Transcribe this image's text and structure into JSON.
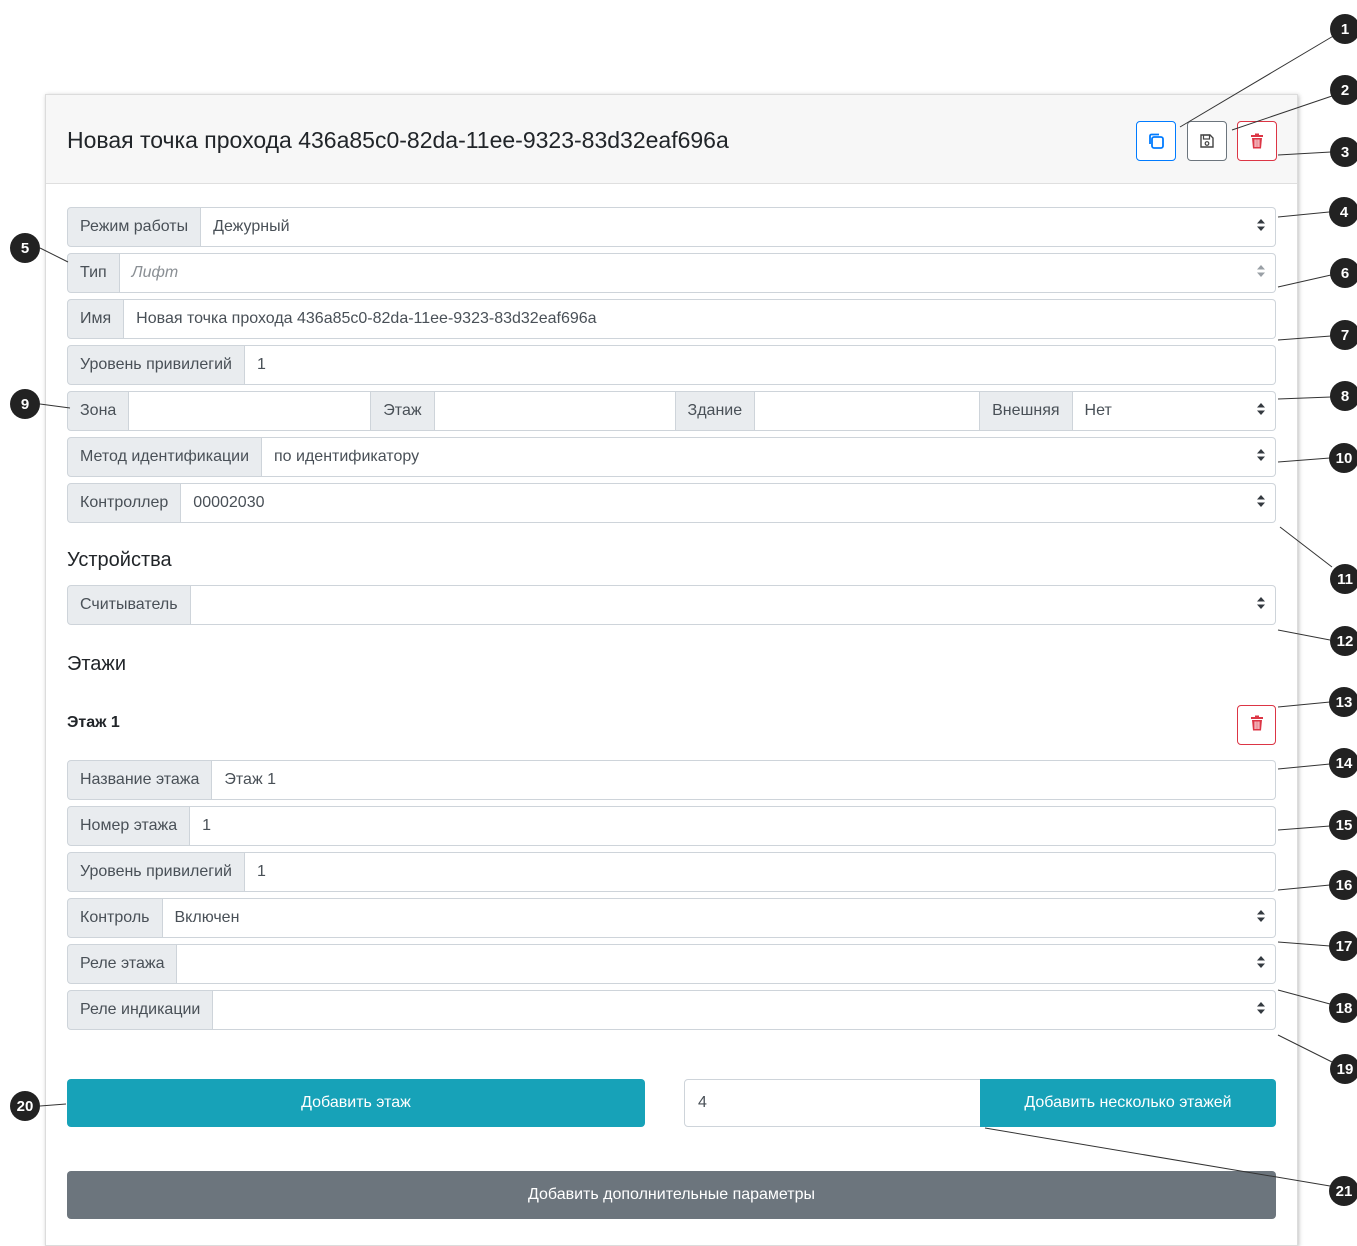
{
  "header": {
    "title": "Новая точка прохода 436a85c0-82da-11ee-9323-83d32eaf696a",
    "copy_icon": "copy-icon",
    "save_icon": "save-icon",
    "delete_icon": "trash-icon"
  },
  "fields": {
    "mode": {
      "label": "Режим работы",
      "value": "Дежурный"
    },
    "type": {
      "label": "Тип",
      "value": "Лифт"
    },
    "name": {
      "label": "Имя",
      "value": "Новая точка прохода 436a85c0-82da-11ee-9323-83d32eaf696a"
    },
    "privilege": {
      "label": "Уровень привилегий",
      "value": "1"
    },
    "zone": {
      "label": "Зона",
      "value": ""
    },
    "floor": {
      "label": "Этаж",
      "value": ""
    },
    "building": {
      "label": "Здание",
      "value": ""
    },
    "external": {
      "label": "Внешняя",
      "value": "Нет"
    },
    "id_method": {
      "label": "Метод идентификации",
      "value": "по идентификатору"
    },
    "controller": {
      "label": "Контроллер",
      "value": "00002030"
    }
  },
  "devices": {
    "heading": "Устройства",
    "reader": {
      "label": "Считыватель",
      "value": ""
    }
  },
  "floors": {
    "heading": "Этажи",
    "items": [
      {
        "title": "Этаж 1",
        "name": {
          "label": "Название этажа",
          "value": "Этаж 1"
        },
        "number": {
          "label": "Номер этажа",
          "value": "1"
        },
        "privilege": {
          "label": "Уровень привилегий",
          "value": "1"
        },
        "control": {
          "label": "Контроль",
          "value": "Включен"
        },
        "relay": {
          "label": "Реле этажа",
          "value": ""
        },
        "indication_relay": {
          "label": "Реле индикации",
          "value": ""
        }
      }
    ]
  },
  "actions": {
    "add_floor": "Добавить этаж",
    "floor_count": "4",
    "add_multiple_floors": "Добавить несколько этажей",
    "add_params": "Добавить дополнительные параметры"
  },
  "callouts": [
    "1",
    "2",
    "3",
    "4",
    "5",
    "6",
    "7",
    "8",
    "9",
    "10",
    "11",
    "12",
    "13",
    "14",
    "15",
    "16",
    "17",
    "18",
    "19",
    "20",
    "21"
  ],
  "colors": {
    "primary": "#007bff",
    "secondary": "#6c757d",
    "danger": "#dc3545",
    "info": "#17a2b8"
  }
}
